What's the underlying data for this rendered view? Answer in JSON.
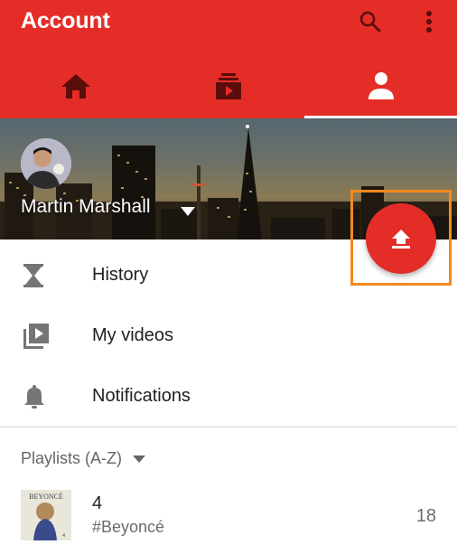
{
  "appbar": {
    "title": "Account",
    "background_color": "#e52d27",
    "icons": {
      "search": "search-icon",
      "more": "more-vert-icon"
    },
    "tabs": [
      {
        "name": "home",
        "icon": "home-icon",
        "active": false
      },
      {
        "name": "subscriptions",
        "icon": "subscriptions-icon",
        "active": false
      },
      {
        "name": "account",
        "icon": "person-icon",
        "active": true
      }
    ]
  },
  "profile": {
    "name": "Martin Marshall",
    "avatar": "avatar",
    "cover": "city-skyline-cover"
  },
  "fab": {
    "icon": "upload-icon",
    "color": "#e52d27",
    "highlight_color": "#f58a1f"
  },
  "menu": [
    {
      "label": "History",
      "icon": "hourglass-icon"
    },
    {
      "label": "My videos",
      "icon": "video-library-icon"
    },
    {
      "label": "Notifications",
      "icon": "bell-icon"
    }
  ],
  "playlists": {
    "header": "Playlists (A-Z)",
    "items": [
      {
        "title": "4",
        "subtitle": "#Beyoncé",
        "count": "18",
        "thumb_text": "BEYONCÉ"
      }
    ]
  }
}
